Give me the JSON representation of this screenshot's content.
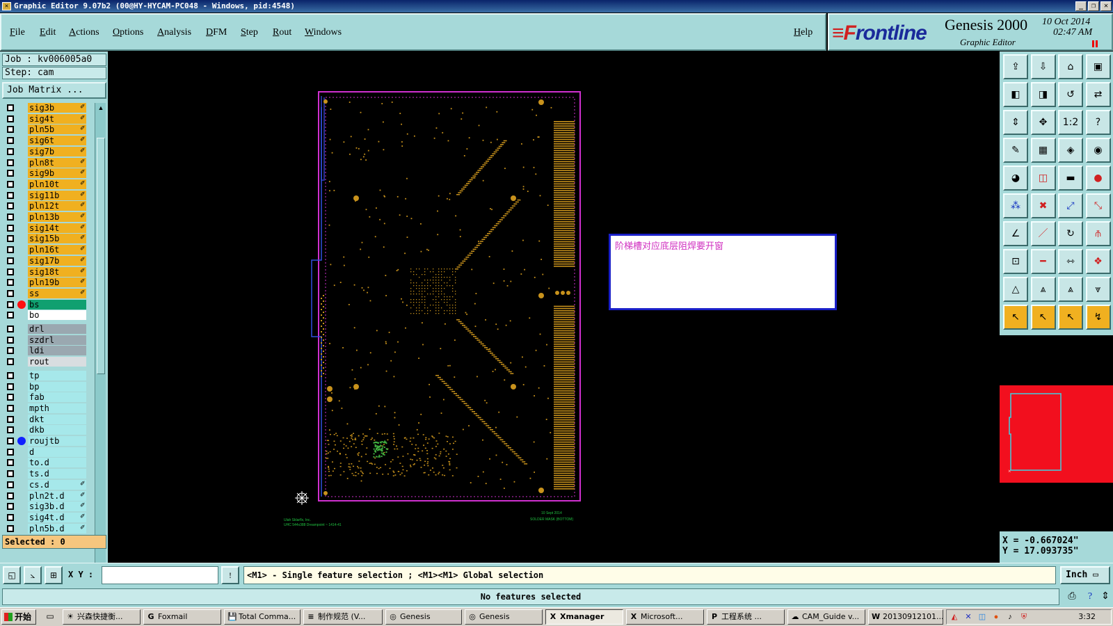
{
  "window": {
    "title": "Graphic Editor 9.07b2 (00@HY-HYCAM-PC048 - Windows, pid:4548)",
    "buttons": [
      "_",
      "❐",
      "✕"
    ]
  },
  "menu": {
    "items": [
      "File",
      "Edit",
      "Actions",
      "Options",
      "Analysis",
      "DFM",
      "Step",
      "Rout",
      "Windows"
    ],
    "help": "Help"
  },
  "brand": {
    "logo_prefix": "≡F",
    "logo_rest": "rontline",
    "product": "Genesis 2000",
    "subtitle": "Graphic Editor",
    "date": "10 Oct 2014",
    "time": "02:47 AM"
  },
  "job": {
    "job_label": "Job : kv006005a0",
    "step_label": "Step: cam",
    "matrix_button": "Job Matrix ..."
  },
  "layers": [
    {
      "name": "sig3b",
      "type": "sig",
      "pen": true
    },
    {
      "name": "sig4t",
      "type": "sig",
      "pen": true
    },
    {
      "name": "pln5b",
      "type": "sig",
      "pen": true
    },
    {
      "name": "sig6t",
      "type": "sig",
      "pen": true
    },
    {
      "name": "sig7b",
      "type": "sig",
      "pen": true
    },
    {
      "name": "pln8t",
      "type": "sig",
      "pen": true
    },
    {
      "name": "sig9b",
      "type": "sig",
      "pen": true
    },
    {
      "name": "pln10t",
      "type": "sig",
      "pen": true
    },
    {
      "name": "sig11b",
      "type": "sig",
      "pen": true
    },
    {
      "name": "pln12t",
      "type": "sig",
      "pen": true
    },
    {
      "name": "pln13b",
      "type": "sig",
      "pen": true
    },
    {
      "name": "sig14t",
      "type": "sig",
      "pen": true
    },
    {
      "name": "sig15b",
      "type": "sig",
      "pen": true
    },
    {
      "name": "pln16t",
      "type": "sig",
      "pen": true
    },
    {
      "name": "sig17b",
      "type": "sig",
      "pen": true
    },
    {
      "name": "sig18t",
      "type": "sig",
      "pen": true
    },
    {
      "name": "pln19b",
      "type": "sig",
      "pen": true
    },
    {
      "name": "ss",
      "type": "sig",
      "pen": true
    },
    {
      "name": "bs",
      "type": "bs",
      "dot": "#ff1010"
    },
    {
      "name": "bo",
      "type": "bo"
    },
    {
      "gap": true
    },
    {
      "name": "drl",
      "type": "drl"
    },
    {
      "name": "szdrl",
      "type": "drl"
    },
    {
      "name": "ldi",
      "type": "drl"
    },
    {
      "name": "rout",
      "type": "rout"
    },
    {
      "gap": true
    },
    {
      "name": "tp",
      "type": "doc"
    },
    {
      "name": "bp",
      "type": "doc"
    },
    {
      "name": "fab",
      "type": "doc"
    },
    {
      "name": "mpth",
      "type": "doc"
    },
    {
      "name": "dkt",
      "type": "doc"
    },
    {
      "name": "dkb",
      "type": "doc"
    },
    {
      "name": "roujtb",
      "type": "doc",
      "dot": "#1020ff"
    },
    {
      "name": "d",
      "type": "doc"
    },
    {
      "name": "to.d",
      "type": "doc"
    },
    {
      "name": "ts.d",
      "type": "doc"
    },
    {
      "name": "cs.d",
      "type": "doc",
      "pen": true
    },
    {
      "name": "pln2t.d",
      "type": "doc",
      "pen": true
    },
    {
      "name": "sig3b.d",
      "type": "doc",
      "pen": true
    },
    {
      "name": "sig4t.d",
      "type": "doc",
      "pen": true
    },
    {
      "name": "pln5b.d",
      "type": "doc",
      "pen": true
    }
  ],
  "selected_label": "Selected : 0",
  "board_notes": {
    "left_line1": "Ulah Sklarflx, Inc.",
    "left_line2": "UHC 544x388 Dreampoint ~ 1414-41",
    "right_line1": "10 Sept 2014",
    "right_line2": "SOLDER MASK (BOTTOM)"
  },
  "comment": {
    "text": "阶梯槽对应底层阻焊要开窗"
  },
  "colors": {
    "app_bg": "#a6d9d9",
    "pad_color": "#c8921c",
    "profile_color": "#d030d0",
    "selected_layer": "#10a070",
    "comment_border": "#1a20c8",
    "comment_text": "#d030c0"
  },
  "toolbox": {
    "tools": [
      "⇪",
      "⇩",
      "⌂",
      "▣",
      "◧",
      "◨",
      "↺",
      "⇄",
      "⇕",
      "✥",
      "1:2",
      "?",
      "✎",
      "▦",
      "◈",
      "◉",
      "◕",
      "◫",
      "▬",
      "●",
      "⁂",
      "✖",
      "⤢",
      "⤡",
      "∠",
      "／",
      "↻",
      "⫚",
      "⊡",
      "━",
      "⇿",
      "❖",
      "△",
      "⩓",
      "⩓",
      "⩔",
      "↖",
      "↖",
      "↖",
      "↯"
    ]
  },
  "coords": {
    "x": "X = -0.667024\"",
    "y": "Y = 17.093735\""
  },
  "command": {
    "xy_label": "X Y :",
    "xy_value": "",
    "prompt": "<M1> - Single feature selection ; <M1><M1> Global selection",
    "unit": "Inch",
    "alert_icon": "!"
  },
  "status": {
    "text": "No features selected"
  },
  "taskbar": {
    "start": "开始",
    "tasks": [
      {
        "label": "兴森快捷衡...",
        "icon": "☀"
      },
      {
        "label": "Foxmail",
        "icon": "G"
      },
      {
        "label": "Total Comma...",
        "icon": "💾"
      },
      {
        "label": "制作规范 (V...",
        "icon": "≡"
      },
      {
        "label": "Genesis",
        "icon": "◎"
      },
      {
        "label": "Genesis",
        "icon": "◎"
      },
      {
        "label": "Xmanager",
        "icon": "X",
        "active": true
      },
      {
        "label": "Microsoft...",
        "icon": "X"
      },
      {
        "label": "工程系统 ...",
        "icon": "P"
      },
      {
        "label": "CAM_Guide v...",
        "icon": "☁"
      },
      {
        "label": "20130912101...",
        "icon": "W"
      }
    ],
    "clock": "3:32"
  }
}
